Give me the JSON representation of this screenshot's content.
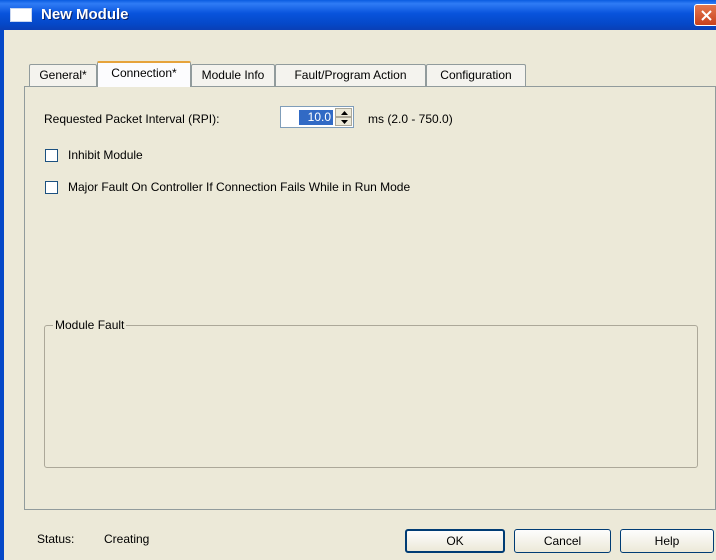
{
  "window": {
    "title": "New Module"
  },
  "tabs": [
    {
      "label": "General*"
    },
    {
      "label": "Connection*"
    },
    {
      "label": "Module Info"
    },
    {
      "label": "Fault/Program Action"
    },
    {
      "label": "Configuration"
    }
  ],
  "connection": {
    "rpi_label": "Requested Packet Interval (RPI):",
    "rpi_value": "10.0",
    "rpi_range": "ms (2.0 - 750.0)",
    "inhibit_label": "Inhibit Module",
    "inhibit_checked": false,
    "major_fault_label": "Major Fault On Controller If Connection Fails While in Run Mode",
    "major_fault_checked": false
  },
  "module_fault": {
    "legend": "Module Fault"
  },
  "status": {
    "label": "Status:",
    "value": "Creating"
  },
  "buttons": {
    "ok": "OK",
    "cancel": "Cancel",
    "help": "Help"
  }
}
